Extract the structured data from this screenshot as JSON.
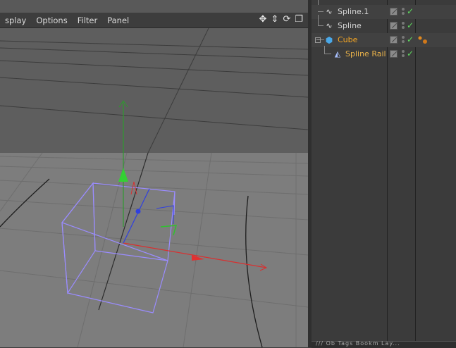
{
  "viewport": {
    "menu": [
      "splay",
      "Options",
      "Filter",
      "Panel"
    ],
    "nav_icons": [
      "move-icon",
      "zoom-icon",
      "rotate-icon",
      "maximize-icon"
    ]
  },
  "objects": {
    "items": [
      {
        "label": "Spline.1",
        "icon": "spline-icon",
        "state": "normal"
      },
      {
        "label": "Spline",
        "icon": "spline-icon",
        "state": "normal"
      },
      {
        "label": "Cube",
        "icon": "cube-icon",
        "state": "selected"
      },
      {
        "label": "Spline Rail",
        "icon": "spline-rail-icon",
        "state": "child-selected"
      }
    ]
  },
  "bottom": {
    "text": "/// Ob Tags Bookm Lay..."
  },
  "colors": {
    "accent": "#f5a623",
    "check": "#5ed85e",
    "axis_x": "#e03030",
    "axis_y": "#30c030",
    "axis_z": "#3040e0",
    "cube_outline": "#9a8cff"
  }
}
